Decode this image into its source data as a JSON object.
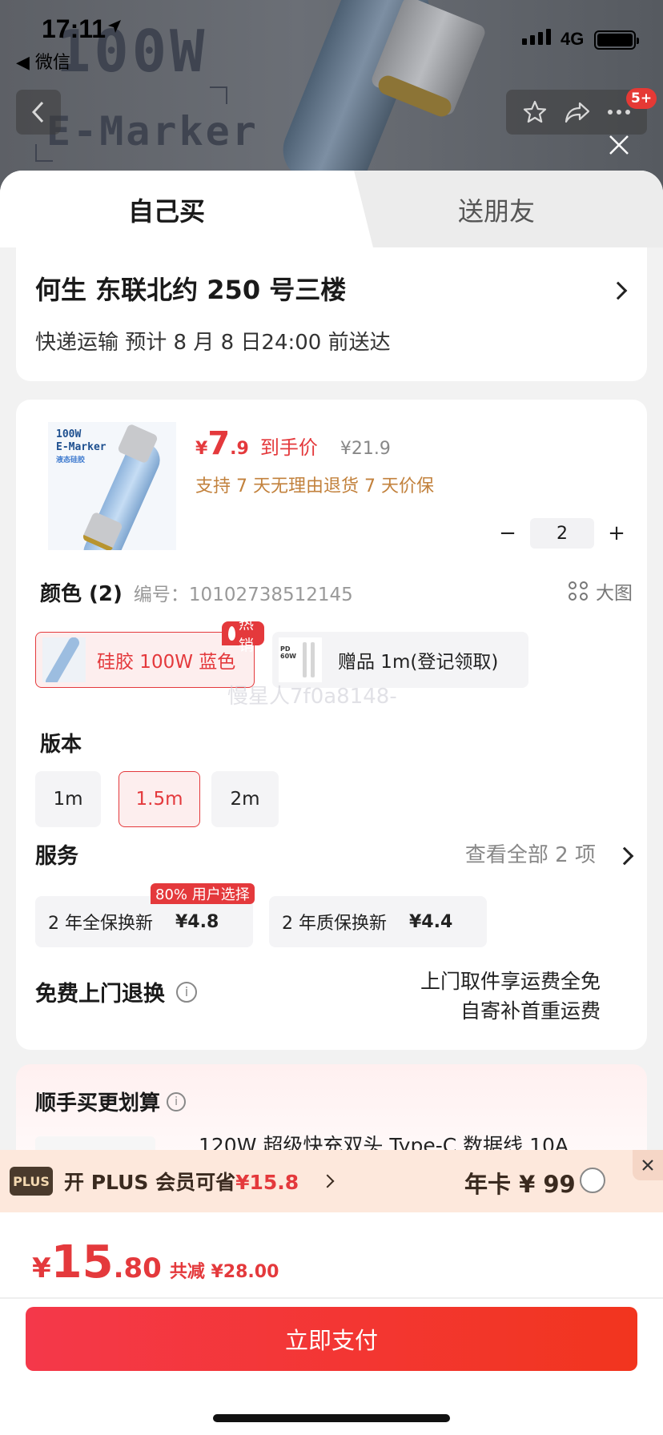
{
  "status_bar": {
    "time": "17:11",
    "back_app": "◀ 微信",
    "network": "4G"
  },
  "background": {
    "headline": "100W",
    "subheadline": "E-Marker",
    "cart_badge": "5+"
  },
  "tabs": [
    {
      "label": "自己买",
      "active": true
    },
    {
      "label": "送朋友",
      "active": false
    }
  ],
  "address": {
    "name_address": "何生  东联北约 250 号三楼",
    "delivery": "快递运输 预计 8 月 8 日24:00 前送达"
  },
  "product": {
    "image_text": [
      "100W",
      "E-Marker",
      "液态硅胶"
    ],
    "price_currency": "¥",
    "price_integer": "7",
    "price_decimal": ".9",
    "price_label": "到手价",
    "original_price": "¥21.9",
    "policy": "支持 7 天无理由退货   7 天价保",
    "quantity": "2",
    "qty_minus": "−",
    "qty_plus": "+"
  },
  "color_section": {
    "title": "颜色 (2)",
    "code": "编号：10102738512145",
    "big_pic": "大图",
    "options": [
      {
        "label": "硅胶 100W 蓝色",
        "selected": true,
        "tag": "热销"
      },
      {
        "label": "赠品 1m(登记领取)",
        "selected": false,
        "thumb_text": [
          "PD",
          "60W"
        ]
      }
    ]
  },
  "watermark": "慢星人7f0a8148-",
  "version_section": {
    "title": "版本",
    "options": [
      {
        "label": "1m",
        "selected": false
      },
      {
        "label": "1.5m",
        "selected": true
      },
      {
        "label": "2m",
        "selected": false
      }
    ]
  },
  "service_section": {
    "title": "服务",
    "more": "查看全部 2 项",
    "tag": "80% 用户选择",
    "options": [
      {
        "label": "2 年全保换新",
        "price": "¥4.8"
      },
      {
        "label": "2 年质保换新",
        "price": "¥4.4"
      }
    ]
  },
  "free_return": {
    "title": "免费上门退换",
    "info": "i",
    "line1": "上门取件享运费全免",
    "line2": "自寄补首重运费"
  },
  "bundle": {
    "title": "顺手买更划算",
    "info": "i",
    "item_name": "120W 超级快充双头 Type-C 数据线 10A"
  },
  "plus_bar": {
    "logo": "PLUS",
    "text_prefix": "开 PLUS 会员可省",
    "save": "¥15.8",
    "year_card": "年卡 ¥ 99"
  },
  "footer": {
    "currency": "¥",
    "total_integer": "15",
    "total_decimal": ".80",
    "discount": "共减 ¥28.00",
    "pay_button": "立即支付"
  },
  "colors": {
    "accent_red": "#e4393c",
    "policy_gold": "#c2813c",
    "plus_bg": "#fde8dc"
  }
}
